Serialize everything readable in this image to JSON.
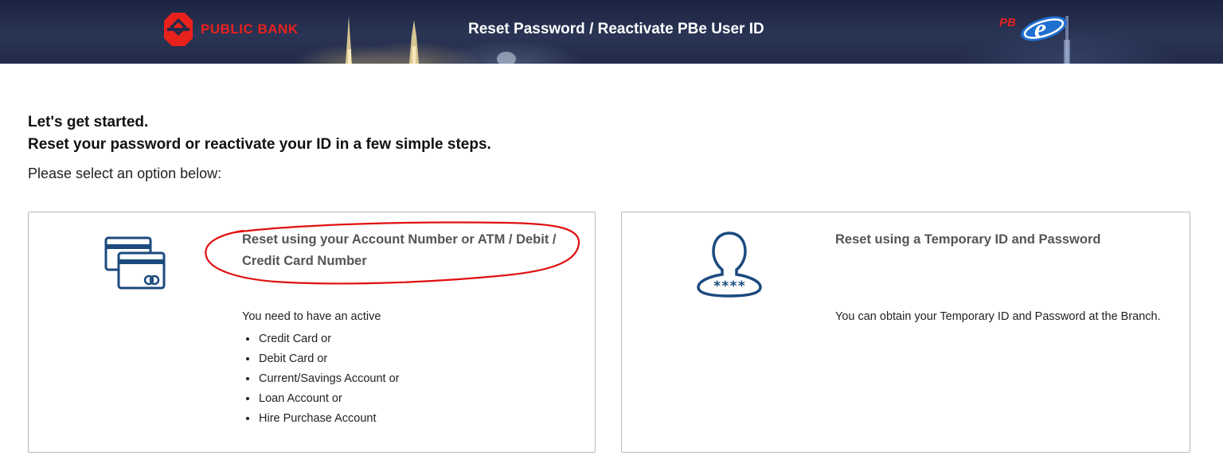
{
  "header": {
    "brand_name": "PUBLIC BANK",
    "title": "Reset Password / Reactivate PBe User ID",
    "logo_pb": "PB",
    "logo_e": "e",
    "brand_color": "#e8211d"
  },
  "intro": {
    "line1": "Let's get started.",
    "line2": "Reset your password or reactivate your ID in a few simple steps.",
    "prompt": "Please select an option below:"
  },
  "options": [
    {
      "icon": "credit-card-icon",
      "title_line1": "Reset using your Account Number or ATM / Debit /",
      "title_line2": "Credit Card Number",
      "description": "You need to have an active",
      "items": [
        "Credit Card or",
        "Debit Card or",
        "Current/Savings Account or",
        "Loan Account or",
        "Hire Purchase Account"
      ]
    },
    {
      "icon": "user-password-icon",
      "title_line1": "Reset using a Temporary ID and Password",
      "description": "You can obtain your Temporary ID and Password at the Branch.",
      "icon_text": "****"
    }
  ],
  "colors": {
    "header_bg": "#222b49",
    "icon_blue": "#1c4a7e",
    "annotation_red": "#e01010",
    "card_border": "#b8b8b8"
  }
}
